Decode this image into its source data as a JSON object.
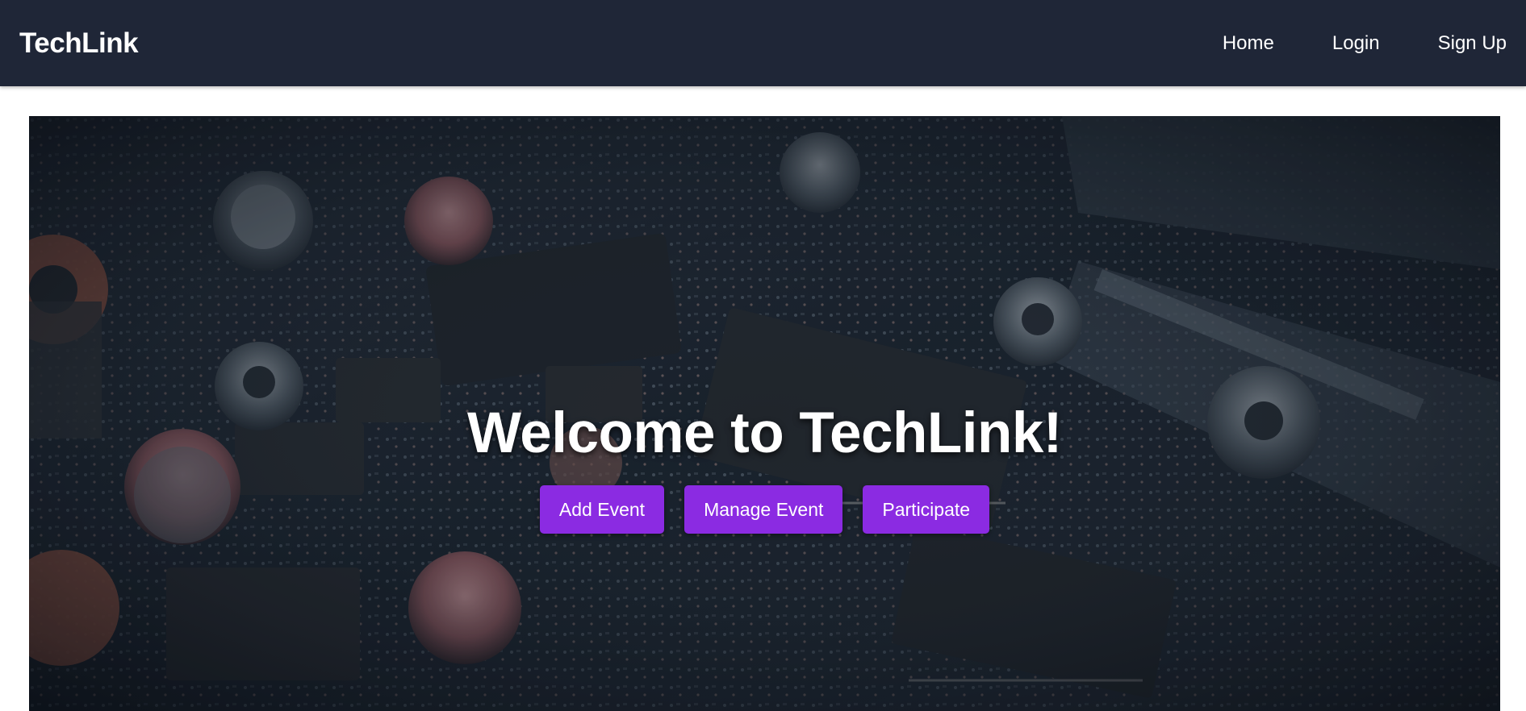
{
  "navbar": {
    "brand": "TechLink",
    "links": [
      {
        "label": "Home"
      },
      {
        "label": "Login"
      },
      {
        "label": "Sign Up"
      }
    ]
  },
  "hero": {
    "title": "Welcome to TechLink!",
    "background_image": "circuit-board-photo",
    "buttons": [
      {
        "label": "Add Event"
      },
      {
        "label": "Manage Event"
      },
      {
        "label": "Participate"
      }
    ]
  },
  "colors": {
    "navbar_bg": "#1f2637",
    "button_bg": "#8b2be2",
    "text": "#ffffff"
  }
}
